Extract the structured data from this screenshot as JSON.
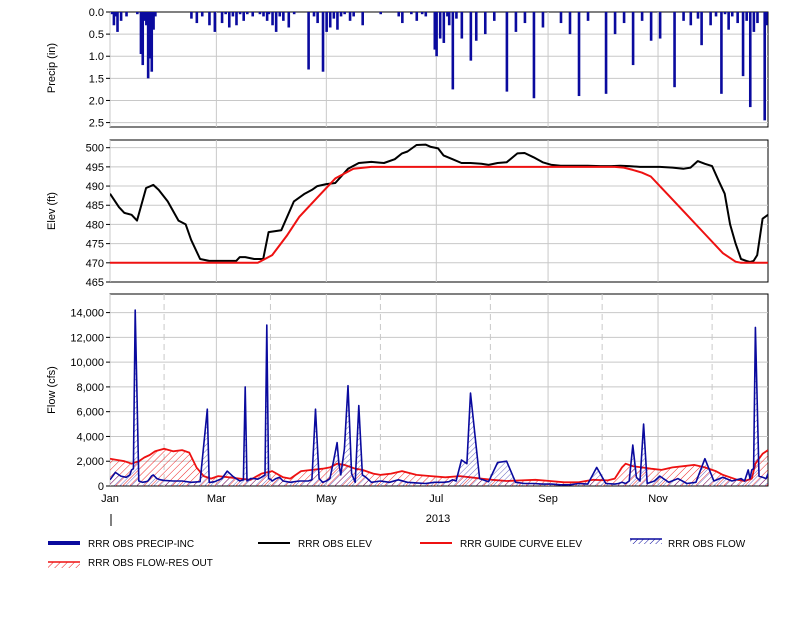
{
  "chart_data": [
    {
      "type": "bar",
      "ylabel": "Precip (in)",
      "ylim": [
        2.6,
        0.0
      ],
      "inverted": true,
      "yticks": [
        "0.0",
        "0.5",
        "1.0",
        "1.5",
        "2.0",
        "2.5"
      ],
      "grid": true,
      "series": [
        {
          "name": "RRR OBS PRECIP-INC",
          "color": "#0a0a9e",
          "days": [
            1,
            2,
            3,
            4,
            6,
            9,
            15,
            17,
            18,
            19,
            20,
            21,
            22,
            23,
            24,
            25,
            45,
            48,
            51,
            55,
            58,
            62,
            64,
            66,
            68,
            70,
            72,
            74,
            76,
            79,
            83,
            85,
            87,
            88,
            90,
            92,
            94,
            96,
            99,
            102,
            110,
            113,
            115,
            118,
            120,
            122,
            124,
            126,
            128,
            130,
            133,
            135,
            140,
            150,
            160,
            162,
            167,
            170,
            173,
            175,
            180,
            181,
            183,
            185,
            187,
            188,
            190,
            192,
            195,
            200,
            203,
            208,
            213,
            220,
            225,
            230,
            235,
            240,
            250,
            255,
            260,
            265,
            275,
            280,
            285,
            290,
            295,
            300,
            305,
            313,
            318,
            322,
            326,
            328,
            333,
            336,
            339,
            341,
            343,
            345,
            348,
            351,
            353,
            355,
            357,
            359,
            363,
            364
          ],
          "values": [
            0.05,
            0.3,
            0.1,
            0.45,
            0.2,
            0.1,
            0.05,
            0.95,
            1.2,
            0.2,
            0.3,
            1.5,
            1.05,
            1.35,
            0.4,
            0.1,
            0.15,
            0.25,
            0.1,
            0.3,
            0.45,
            0.25,
            0.05,
            0.35,
            0.1,
            0.3,
            0.05,
            0.2,
            0.05,
            0.1,
            0.05,
            0.1,
            0.2,
            0.05,
            0.3,
            0.45,
            0.1,
            0.2,
            0.35,
            0.05,
            1.3,
            0.1,
            0.25,
            1.35,
            0.45,
            0.35,
            0.15,
            0.4,
            0.1,
            0.05,
            0.2,
            0.1,
            0.3,
            0.05,
            0.1,
            0.25,
            0.05,
            0.2,
            0.05,
            0.1,
            0.85,
            1.0,
            0.6,
            0.7,
            0.1,
            0.3,
            1.75,
            0.15,
            0.6,
            1.1,
            0.65,
            0.5,
            0.2,
            1.8,
            0.45,
            0.25,
            1.95,
            0.35,
            0.25,
            0.5,
            1.9,
            0.2,
            1.85,
            0.5,
            0.25,
            1.2,
            0.2,
            0.65,
            0.6,
            1.7,
            0.2,
            0.3,
            0.15,
            0.75,
            0.3,
            0.1,
            1.85,
            0.05,
            0.4,
            0.1,
            0.25,
            1.45,
            0.2,
            2.15,
            0.45,
            0.25,
            2.45,
            0.3,
            0.1,
            0.15,
            0.4,
            0.1,
            0.85,
            0.2,
            0.05,
            0.1,
            0.3,
            0.6,
            0.3,
            0.55,
            0.6,
            0.35,
            0.3,
            0.1,
            0.8,
            0.3,
            0.6,
            0.15,
            0.5,
            0.1,
            0.05,
            0.2,
            0.1,
            0.15,
            0.4,
            0.35
          ]
        }
      ]
    },
    {
      "type": "line",
      "ylabel": "Elev (ft)",
      "ylim": [
        465,
        502
      ],
      "yticks": [
        "465",
        "470",
        "475",
        "480",
        "485",
        "490",
        "495",
        "500"
      ],
      "grid": true,
      "series": [
        {
          "name": "RRR OBS ELEV",
          "color": "#000000",
          "days": [
            0,
            5,
            8,
            12,
            15,
            20,
            24,
            27,
            32,
            38,
            42,
            45,
            50,
            55,
            60,
            65,
            70,
            72,
            75,
            80,
            85,
            88,
            95,
            102,
            108,
            112,
            115,
            120,
            125,
            132,
            138,
            145,
            152,
            158,
            162,
            165,
            170,
            175,
            178,
            182,
            185,
            190,
            195,
            200,
            206,
            210,
            215,
            220,
            226,
            230,
            235,
            240,
            245,
            250,
            258,
            265,
            272,
            278,
            283,
            288,
            294,
            300,
            305,
            312,
            318,
            322,
            326,
            330,
            334,
            338,
            341,
            344,
            347,
            350,
            353,
            355,
            357,
            359,
            362,
            365
          ],
          "values": [
            488,
            484.5,
            483,
            482.5,
            481,
            489.5,
            490.3,
            489,
            486,
            481,
            480,
            476,
            471,
            470.5,
            470.5,
            470.5,
            470.5,
            471.5,
            471.5,
            471,
            471,
            478,
            478.5,
            486,
            488,
            489,
            490,
            490.5,
            490.8,
            494.5,
            496,
            496.3,
            496,
            497,
            498.5,
            499,
            500.7,
            500.8,
            500.2,
            499.8,
            498,
            497,
            496,
            496,
            495.8,
            495.5,
            496,
            496.2,
            498.5,
            498.6,
            497.5,
            496.2,
            495.5,
            495.3,
            495.3,
            495.3,
            495.2,
            495.2,
            495.3,
            495.2,
            495,
            495,
            495,
            494.8,
            494.5,
            494.8,
            496.5,
            495.8,
            495.2,
            491,
            488,
            480,
            475,
            471,
            470.5,
            470.2,
            470.5,
            472,
            481.5,
            482.5,
            481.5,
            479,
            475
          ]
        },
        {
          "name": "RRR GUIDE CURVE ELEV",
          "color": "#ee1111",
          "days": [
            0,
            73,
            75,
            82,
            90,
            98,
            105,
            115,
            125,
            135,
            145,
            152,
            155,
            160,
            170,
            180,
            195,
            210,
            225,
            240,
            255,
            265,
            270,
            275,
            280,
            285,
            290,
            295,
            300,
            305,
            310,
            320,
            330,
            340,
            347,
            350,
            355,
            365
          ],
          "values": [
            470,
            470,
            470,
            470,
            472,
            477,
            482,
            487,
            492,
            494.5,
            495,
            495,
            495,
            495,
            495,
            495,
            495,
            495,
            495,
            495,
            495,
            495,
            495,
            495,
            495,
            494.8,
            494.2,
            493.5,
            492.5,
            490,
            487.5,
            482.5,
            477.5,
            472.5,
            470.3,
            470,
            470,
            470
          ]
        }
      ]
    },
    {
      "type": "area",
      "ylabel": "Flow (cfs)",
      "ylim": [
        0,
        15500
      ],
      "yticks": [
        "0",
        "2,000",
        "4,000",
        "6,000",
        "8,000",
        "10,000",
        "12,000",
        "14,000"
      ],
      "xlabel": "2013",
      "xticks": [
        "Jan",
        "Mar",
        "May",
        "Jul",
        "Sep",
        "Nov"
      ],
      "xtick_days": [
        0,
        59,
        120,
        181,
        243,
        304
      ],
      "grid": true,
      "series": [
        {
          "name": "RRR OBS FLOW",
          "color": "#0a0a9e",
          "days": [
            0,
            3,
            6,
            9,
            11,
            12,
            13,
            14,
            16,
            18,
            20,
            21,
            22,
            23,
            24,
            26,
            28,
            30,
            35,
            40,
            45,
            50,
            54,
            55,
            56,
            58,
            62,
            65,
            68,
            70,
            72,
            74,
            75,
            76,
            78,
            80,
            82,
            84,
            86,
            87,
            88,
            89,
            90,
            92,
            94,
            96,
            100,
            105,
            110,
            112,
            114,
            116,
            118,
            120,
            122,
            124,
            126,
            127,
            128,
            130,
            132,
            134,
            136,
            138,
            140,
            142,
            145,
            150,
            155,
            160,
            165,
            170,
            175,
            180,
            185,
            188,
            190,
            192,
            195,
            198,
            200,
            205,
            210,
            215,
            220,
            225,
            230,
            235,
            240,
            245,
            250,
            255,
            260,
            265,
            270,
            275,
            280,
            282,
            284,
            286,
            288,
            290,
            292,
            294,
            296,
            298,
            300,
            302,
            305,
            310,
            315,
            320,
            325,
            330,
            335,
            340,
            345,
            350,
            352,
            354,
            355,
            356,
            357,
            358,
            360,
            362,
            364,
            365
          ],
          "values": [
            500,
            1100,
            800,
            700,
            900,
            1300,
            1400,
            14200,
            400,
            300,
            350,
            400,
            600,
            800,
            900,
            600,
            500,
            450,
            400,
            400,
            300,
            350,
            6200,
            300,
            300,
            350,
            600,
            1200,
            800,
            600,
            400,
            500,
            8000,
            400,
            600,
            600,
            550,
            700,
            900,
            13000,
            600,
            550,
            400,
            600,
            700,
            400,
            300,
            400,
            400,
            500,
            6200,
            600,
            300,
            400,
            600,
            2000,
            3500,
            1800,
            900,
            3000,
            8100,
            1000,
            300,
            6500,
            900,
            700,
            300,
            400,
            300,
            500,
            300,
            250,
            200,
            300,
            300,
            350,
            500,
            400,
            2100,
            1800,
            7500,
            600,
            350,
            1900,
            2000,
            300,
            200,
            200,
            150,
            150,
            100,
            100,
            200,
            150,
            1500,
            200,
            150,
            200,
            300,
            200,
            400,
            3300,
            700,
            400,
            5000,
            200,
            300,
            400,
            800,
            300,
            600,
            200,
            300,
            2200,
            400,
            700,
            400,
            600,
            400,
            1300,
            600,
            1300,
            1400,
            12800,
            800,
            700,
            600,
            1000,
            900,
            1100
          ]
        },
        {
          "name": "RRR OBS FLOW-RES OUT",
          "color": "#ee1111",
          "days": [
            0,
            4,
            8,
            12,
            16,
            19,
            22,
            25,
            30,
            35,
            40,
            44,
            48,
            52,
            56,
            60,
            66,
            72,
            78,
            84,
            90,
            96,
            100,
            106,
            112,
            118,
            122,
            126,
            130,
            136,
            140,
            146,
            150,
            156,
            162,
            170,
            178,
            186,
            194,
            200,
            206,
            212,
            220,
            228,
            236,
            244,
            252,
            260,
            268,
            276,
            280,
            284,
            286,
            290,
            295,
            300,
            306,
            312,
            318,
            324,
            330,
            336,
            340,
            344,
            348,
            352,
            356,
            358,
            360,
            362,
            365
          ],
          "values": [
            2200,
            2100,
            2000,
            1800,
            2000,
            2300,
            2500,
            2800,
            3000,
            2800,
            2900,
            2700,
            1500,
            800,
            600,
            800,
            700,
            600,
            500,
            1000,
            1200,
            700,
            600,
            1200,
            1300,
            1400,
            1500,
            1800,
            1700,
            1400,
            1300,
            1000,
            900,
            1000,
            1200,
            900,
            800,
            700,
            800,
            700,
            600,
            500,
            400,
            450,
            500,
            400,
            300,
            300,
            500,
            450,
            600,
            1500,
            1800,
            1600,
            1500,
            1400,
            1300,
            1500,
            1600,
            1700,
            1500,
            1200,
            900,
            700,
            500,
            400,
            600,
            1800,
            2200,
            2600,
            2900
          ]
        }
      ]
    }
  ],
  "legend": [
    {
      "label": "RRR OBS PRECIP-INC",
      "style": "thick-line",
      "color": "#0a0a9e"
    },
    {
      "label": "RRR OBS ELEV",
      "style": "line",
      "color": "#000000"
    },
    {
      "label": "RRR GUIDE CURVE ELEV",
      "style": "line",
      "color": "#ee1111"
    },
    {
      "label": "RRR OBS FLOW",
      "style": "hatch-line",
      "color": "#0a0a9e"
    },
    {
      "label": "RRR OBS FLOW-RES OUT",
      "style": "hatch-line",
      "color": "#ee1111"
    }
  ]
}
